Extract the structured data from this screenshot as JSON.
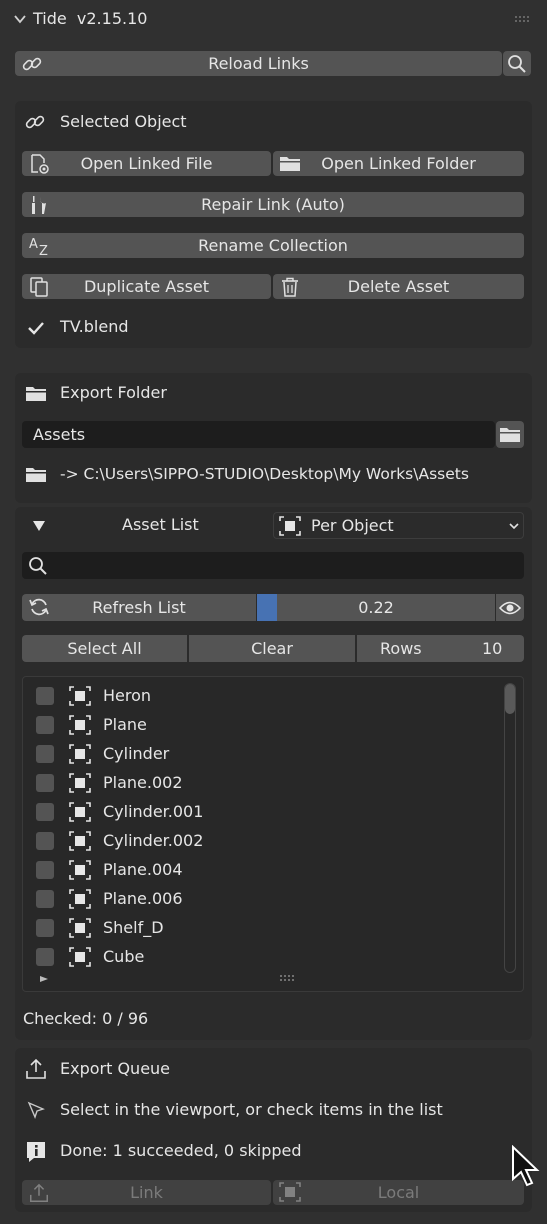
{
  "header": {
    "title": "Tide  v2.15.10"
  },
  "top": {
    "reload_label": "Reload Links"
  },
  "selected": {
    "title": "Selected Object",
    "open_file": "Open Linked File",
    "open_folder": "Open Linked Folder",
    "repair": "Repair Link (Auto)",
    "rename": "Rename Collection",
    "duplicate": "Duplicate Asset",
    "delete": "Delete Asset",
    "file": "TV.blend"
  },
  "export_folder": {
    "title": "Export Folder",
    "value": "Assets",
    "path": "-> C:\\Users\\SIPPO-STUDIO\\Desktop\\My Works\\Assets"
  },
  "asset_list": {
    "title": "Asset List",
    "mode": "Per Object",
    "search_value": "",
    "refresh": "Refresh List",
    "slider_value": "0.22",
    "slider_fraction": 0.22,
    "select_all": "Select All",
    "clear": "Clear",
    "rows_label": "Rows",
    "rows_value": "10",
    "items": [
      "Heron",
      "Plane",
      "Cylinder",
      "Plane.002",
      "Cylinder.001",
      "Cylinder.002",
      "Plane.004",
      "Plane.006",
      "Shelf_D",
      "Cube"
    ],
    "checked": "Checked: 0 / 96"
  },
  "export_queue": {
    "title": "Export Queue",
    "hint": "Select in the viewport, or check items in the list",
    "status": "Done: 1 succeeded, 0 skipped",
    "link": "Link",
    "local": "Local"
  },
  "colors": {
    "accent": "#4772b3",
    "panel": "#2b2b2b",
    "button": "#545454",
    "field": "#1d1d1d"
  }
}
